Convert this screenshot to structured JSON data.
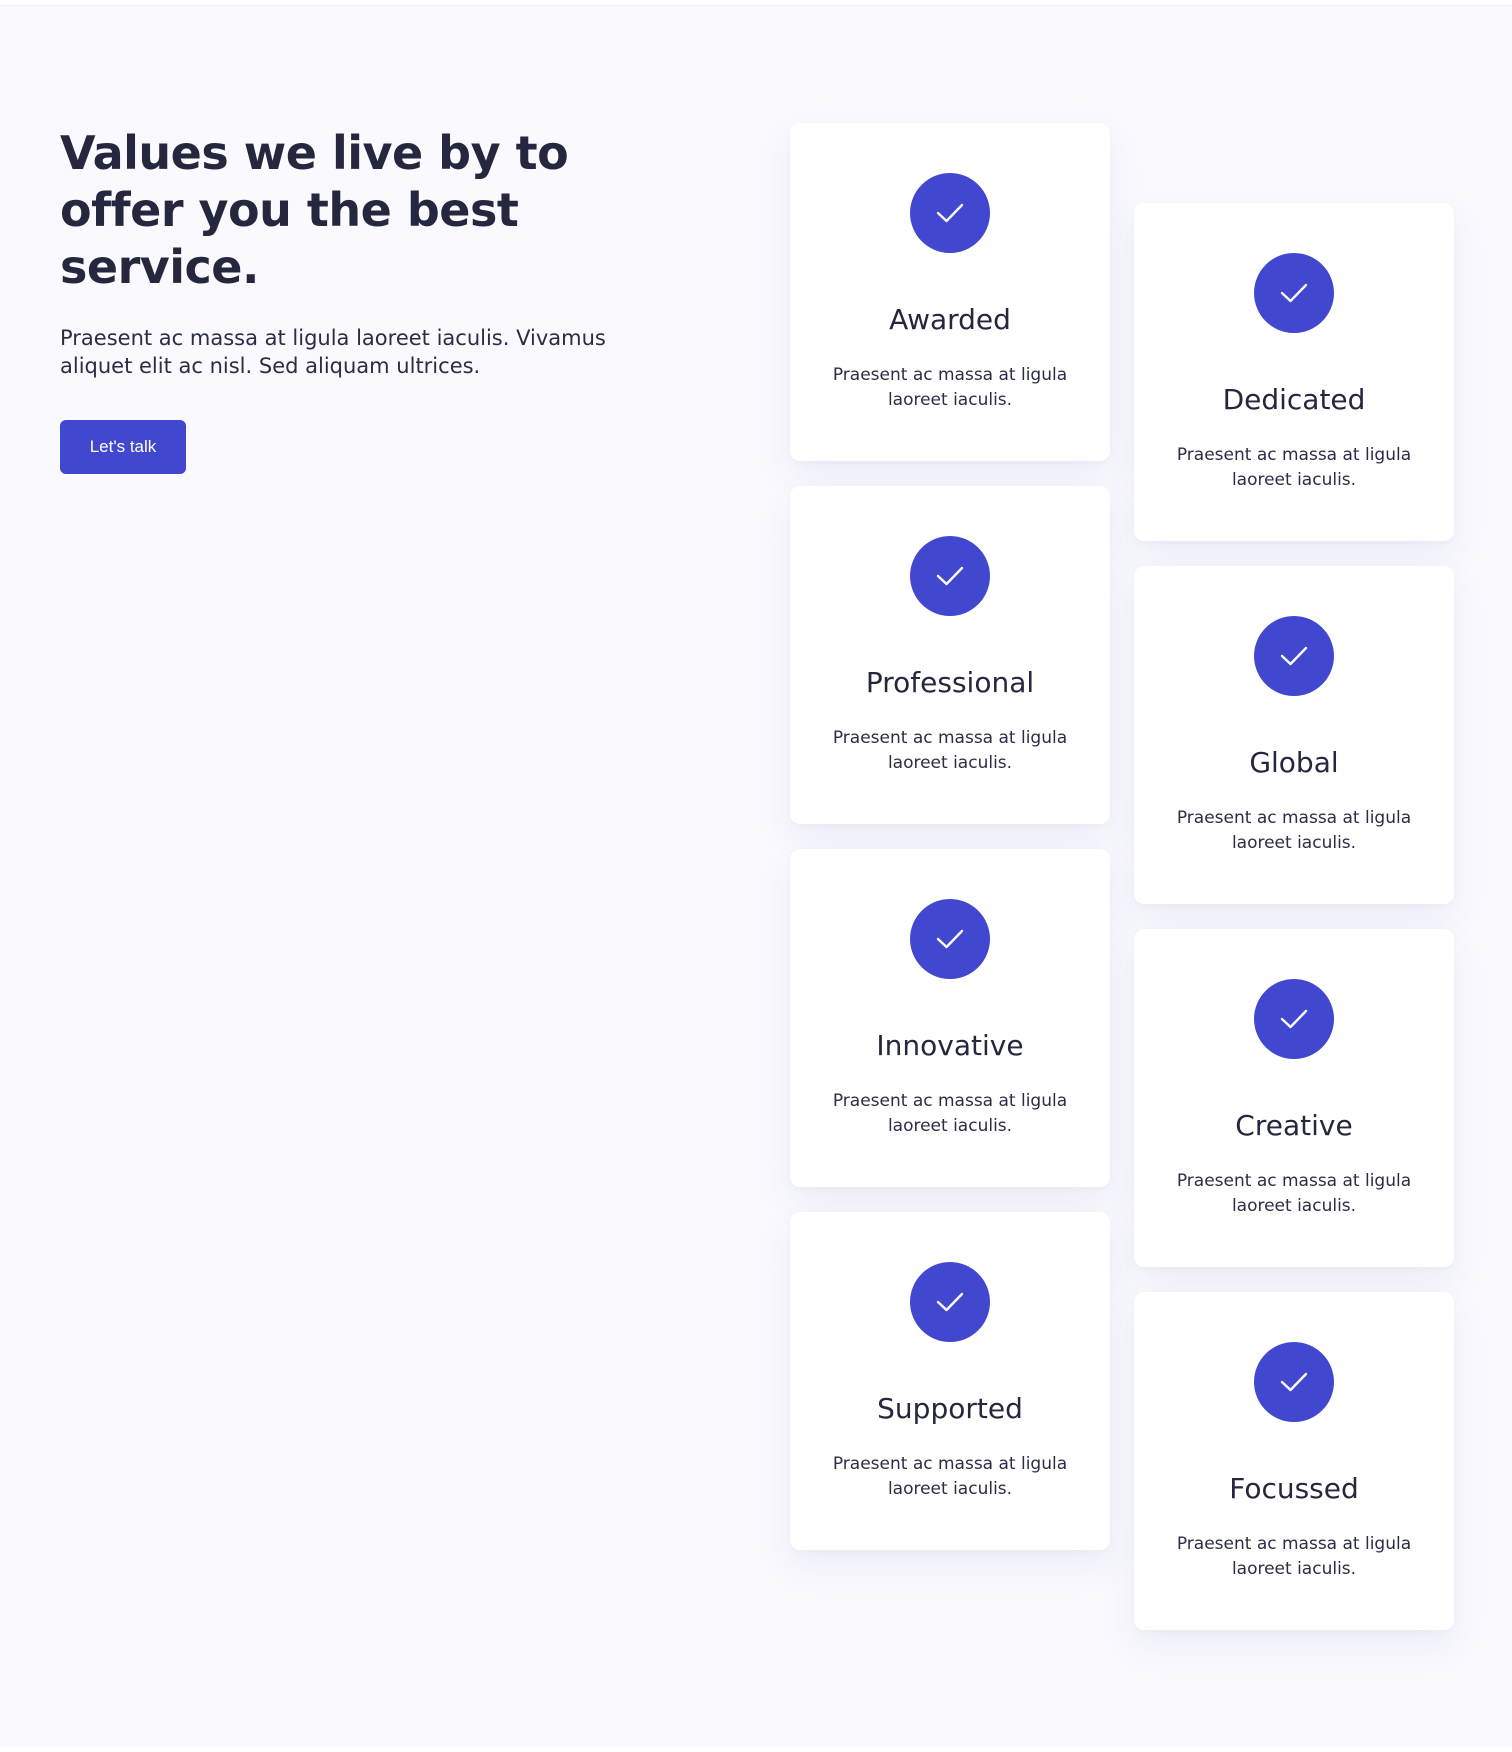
{
  "intro": {
    "headline": "Values we live by to offer you the best service.",
    "lead": "Praesent ac massa at ligula laoreet iaculis. Vivamus aliquet elit ac nisl. Sed aliquam ultrices.",
    "cta_label": "Let's talk"
  },
  "values": [
    {
      "title": "Awarded",
      "text": "Praesent ac massa at ligula laoreet iaculis.",
      "icon": "check-icon"
    },
    {
      "title": "Dedicated",
      "text": "Praesent ac massa at ligula laoreet iaculis.",
      "icon": "check-icon"
    },
    {
      "title": "Professional",
      "text": "Praesent ac massa at ligula laoreet iaculis.",
      "icon": "check-icon"
    },
    {
      "title": "Global",
      "text": "Praesent ac massa at ligula laoreet iaculis.",
      "icon": "check-icon"
    },
    {
      "title": "Innovative",
      "text": "Praesent ac massa at ligula laoreet iaculis.",
      "icon": "check-icon"
    },
    {
      "title": "Creative",
      "text": "Praesent ac massa at ligula laoreet iaculis.",
      "icon": "check-icon"
    },
    {
      "title": "Supported",
      "text": "Praesent ac massa at ligula laoreet iaculis.",
      "icon": "check-icon"
    },
    {
      "title": "Focussed",
      "text": "Praesent ac massa at ligula laoreet iaculis.",
      "icon": "check-icon"
    }
  ],
  "colors": {
    "accent": "#4147cf",
    "heading": "#25273e",
    "background": "#f9f9fe",
    "card": "#ffffff"
  }
}
